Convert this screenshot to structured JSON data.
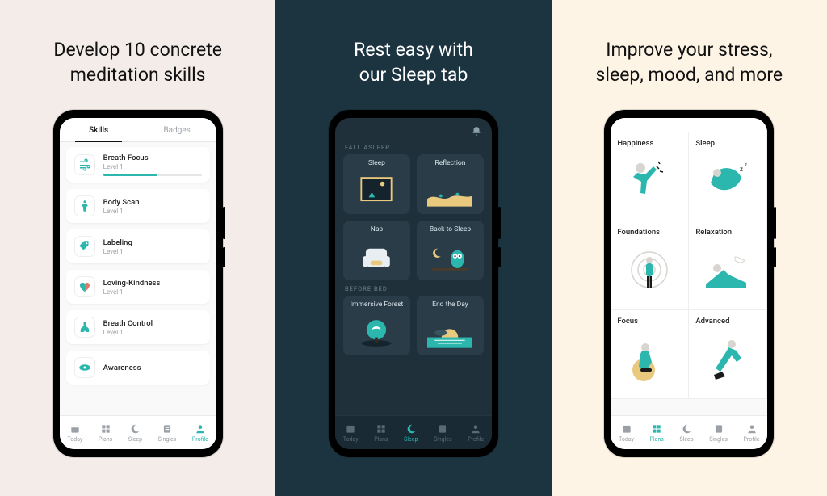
{
  "colors": {
    "teal": "#2bb6ae",
    "navy": "#1b3440",
    "cream1": "#f4ece8",
    "cream3": "#fdf4e6"
  },
  "nav": {
    "items": [
      "Today",
      "Plans",
      "Sleep",
      "Singles",
      "Profile"
    ]
  },
  "panel1": {
    "headline_a": "Develop 10 concrete",
    "headline_b": "meditation skills",
    "tabs": {
      "skills": "Skills",
      "badges": "Badges"
    },
    "skills": [
      {
        "name": "Breath Focus",
        "level": "Level 1",
        "icon": "wind-icon",
        "has_progress": true
      },
      {
        "name": "Body Scan",
        "level": "Level 1",
        "icon": "body-icon",
        "has_progress": false
      },
      {
        "name": "Labeling",
        "level": "Level 1",
        "icon": "tag-icon",
        "has_progress": false
      },
      {
        "name": "Loving-Kindness",
        "level": "Level 1",
        "icon": "heart-icon",
        "has_progress": false
      },
      {
        "name": "Breath Control",
        "level": "Level 1",
        "icon": "lungs-icon",
        "has_progress": false
      },
      {
        "name": "Awareness",
        "level": "",
        "icon": "eye-icon",
        "has_progress": false
      }
    ],
    "nav_active": 4
  },
  "panel2": {
    "headline_a": "Rest easy with",
    "headline_b": "our Sleep tab",
    "section1": "FALL ASLEEP",
    "section2": "BEFORE BED",
    "tiles1": [
      {
        "title": "Sleep",
        "icon": "sleep-window-icon"
      },
      {
        "title": "Reflection",
        "icon": "desert-icon"
      },
      {
        "title": "Nap",
        "icon": "armchair-icon"
      },
      {
        "title": "Back to Sleep",
        "icon": "owl-icon"
      }
    ],
    "tiles2": [
      {
        "title": "Immersive Forest",
        "icon": "tree-icon"
      },
      {
        "title": "End the Day",
        "icon": "sunset-icon"
      }
    ],
    "nav_active": 2
  },
  "panel3": {
    "headline_a": "Improve your stress,",
    "headline_b": "sleep, mood, and more",
    "categories": [
      {
        "title": "Happiness",
        "icon": "jumping-person-icon"
      },
      {
        "title": "Sleep",
        "icon": "sleeping-person-icon"
      },
      {
        "title": "Foundations",
        "icon": "radar-person-icon"
      },
      {
        "title": "Relaxation",
        "icon": "lounging-person-icon"
      },
      {
        "title": "Focus",
        "icon": "kneeling-person-icon"
      },
      {
        "title": "Advanced",
        "icon": "running-person-icon"
      }
    ],
    "nav_active": 1
  }
}
